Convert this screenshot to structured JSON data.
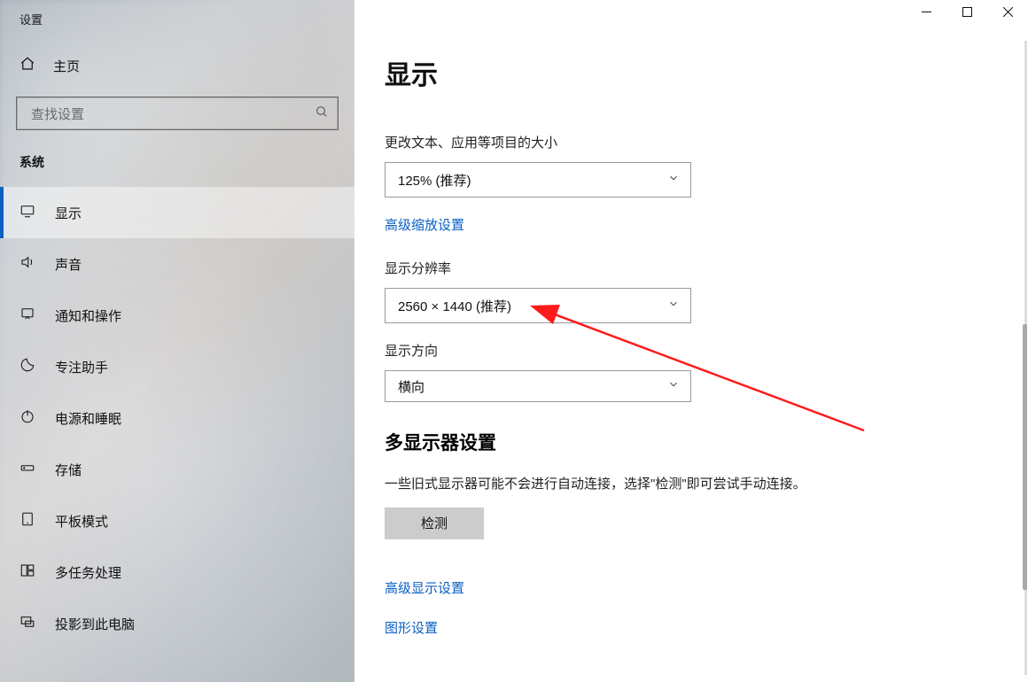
{
  "window": {
    "title": "设置"
  },
  "titlebar": {
    "minimize": "最小化",
    "maximize": "最大化",
    "close": "关闭"
  },
  "sidebar": {
    "home_label": "主页",
    "search_placeholder": "查找设置",
    "category_label": "系统",
    "items": [
      {
        "icon": "display",
        "label": "显示",
        "active": true
      },
      {
        "icon": "sound",
        "label": "声音",
        "active": false
      },
      {
        "icon": "notify",
        "label": "通知和操作",
        "active": false
      },
      {
        "icon": "focus",
        "label": "专注助手",
        "active": false
      },
      {
        "icon": "power",
        "label": "电源和睡眠",
        "active": false
      },
      {
        "icon": "storage",
        "label": "存储",
        "active": false
      },
      {
        "icon": "tablet",
        "label": "平板模式",
        "active": false
      },
      {
        "icon": "multitask",
        "label": "多任务处理",
        "active": false
      },
      {
        "icon": "project",
        "label": "投影到此电脑",
        "active": false
      }
    ]
  },
  "main": {
    "title": "显示",
    "scale": {
      "label": "更改文本、应用等项目的大小",
      "value": "125% (推荐)",
      "adv_link": "高级缩放设置"
    },
    "resolution": {
      "label": "显示分辨率",
      "value": "2560 × 1440 (推荐)"
    },
    "orientation": {
      "label": "显示方向",
      "value": "横向"
    },
    "multi": {
      "heading": "多显示器设置",
      "desc": "一些旧式显示器可能不会进行自动连接，选择\"检测\"即可尝试手动连接。",
      "detect_button": "检测"
    },
    "links": {
      "adv_display": "高级显示设置",
      "graphics": "图形设置"
    }
  }
}
